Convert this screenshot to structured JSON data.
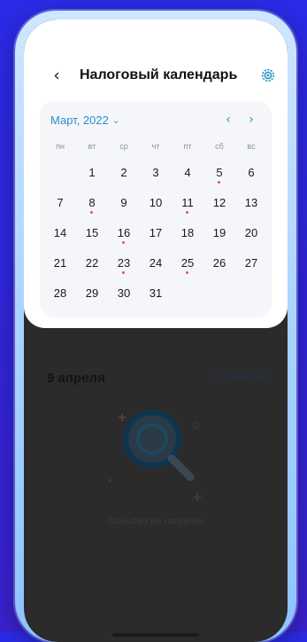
{
  "header": {
    "back_icon": "chevron-left-icon",
    "title": "Налоговый календарь",
    "settings_icon": "gear-icon"
  },
  "calendar": {
    "month_label": "Март, 2022",
    "accent_color": "#2a8fc8",
    "event_dot_color": "#e2574c",
    "weekdays": [
      "пн",
      "вт",
      "ср",
      "чт",
      "пт",
      "сб",
      "вс"
    ],
    "weeks": [
      [
        {
          "day": "",
          "dot": false
        },
        {
          "day": "1",
          "dot": false
        },
        {
          "day": "2",
          "dot": false
        },
        {
          "day": "3",
          "dot": false
        },
        {
          "day": "4",
          "dot": false
        },
        {
          "day": "5",
          "dot": true
        },
        {
          "day": "6",
          "dot": false
        }
      ],
      [
        {
          "day": "7",
          "dot": false
        },
        {
          "day": "8",
          "dot": true
        },
        {
          "day": "9",
          "dot": false
        },
        {
          "day": "10",
          "dot": false
        },
        {
          "day": "11",
          "dot": true
        },
        {
          "day": "12",
          "dot": false
        },
        {
          "day": "13",
          "dot": false
        }
      ],
      [
        {
          "day": "14",
          "dot": false
        },
        {
          "day": "15",
          "dot": false
        },
        {
          "day": "16",
          "dot": true
        },
        {
          "day": "17",
          "dot": false
        },
        {
          "day": "18",
          "dot": false
        },
        {
          "day": "19",
          "dot": false
        },
        {
          "day": "20",
          "dot": false
        }
      ],
      [
        {
          "day": "21",
          "dot": false
        },
        {
          "day": "22",
          "dot": false
        },
        {
          "day": "23",
          "dot": true
        },
        {
          "day": "24",
          "dot": false
        },
        {
          "day": "25",
          "dot": true
        },
        {
          "day": "26",
          "dot": false
        },
        {
          "day": "27",
          "dot": false
        }
      ],
      [
        {
          "day": "28",
          "dot": false
        },
        {
          "day": "29",
          "dot": false
        },
        {
          "day": "30",
          "dot": false
        },
        {
          "day": "31",
          "dot": false
        },
        {
          "day": "",
          "dot": false
        },
        {
          "day": "",
          "dot": false
        },
        {
          "day": "",
          "dot": false
        }
      ]
    ]
  },
  "events": {
    "date_heading": "9 апреля",
    "see_all_label": "См. весь год",
    "empty_text": "События не найдены",
    "empty_icon": "magnifier-icon"
  }
}
